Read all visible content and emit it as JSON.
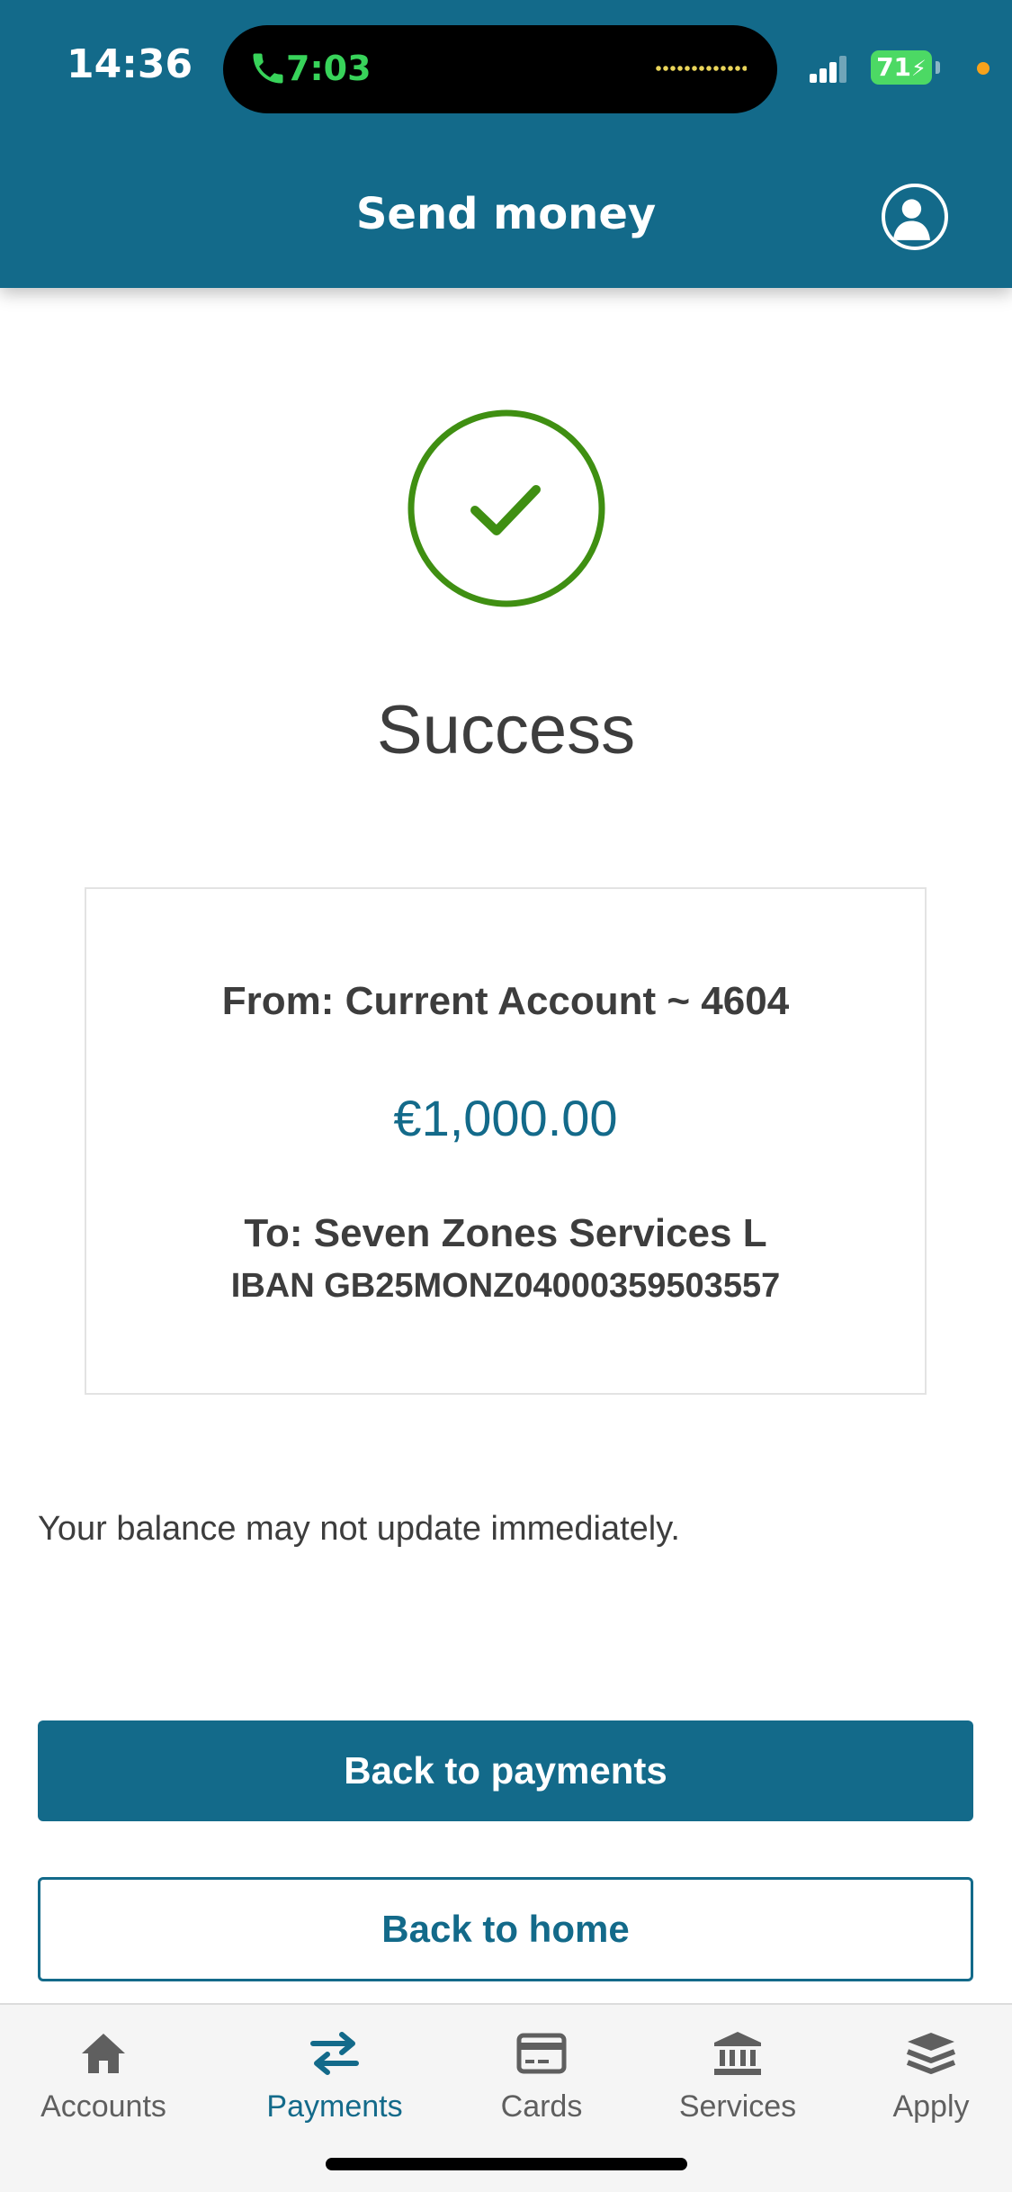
{
  "status_bar": {
    "time": "14:36",
    "call_duration": "7:03",
    "battery": "71"
  },
  "header": {
    "title": "Send money"
  },
  "result": {
    "title": "Success"
  },
  "transfer": {
    "from": "From: Current Account ~ 4604",
    "amount": "€1,000.00",
    "to": "To: Seven Zones Services L",
    "iban": "IBAN GB25MONZ04000359503557"
  },
  "notice": "Your balance may not update immediately.",
  "buttons": {
    "back_to_payments": "Back to payments",
    "back_to_home": "Back to home"
  },
  "tabs": [
    {
      "label": "Accounts",
      "icon": "home-icon",
      "active": false
    },
    {
      "label": "Payments",
      "icon": "transfer-arrows-icon",
      "active": true
    },
    {
      "label": "Cards",
      "icon": "card-icon",
      "active": false
    },
    {
      "label": "Services",
      "icon": "bank-icon",
      "active": false
    },
    {
      "label": "Apply",
      "icon": "layers-icon",
      "active": false
    }
  ],
  "colors": {
    "brand": "#136a8a",
    "success": "#3f8f12"
  }
}
